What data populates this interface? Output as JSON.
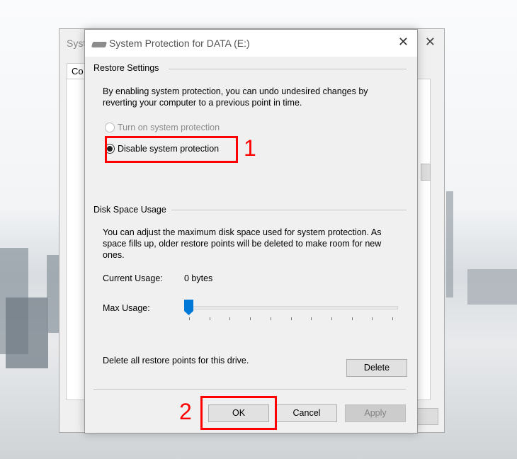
{
  "background_window": {
    "title_fragment": "Syst",
    "tab_fragment": "Co"
  },
  "dialog": {
    "title": "System Protection for DATA (E:)",
    "restore_settings": {
      "heading": "Restore Settings",
      "description": "By enabling system protection, you can undo undesired changes by reverting your computer to a previous point in time.",
      "options": [
        {
          "label": "Turn on system protection",
          "selected": false,
          "enabled": false
        },
        {
          "label": "Disable system protection",
          "selected": true,
          "enabled": true
        }
      ]
    },
    "disk_space": {
      "heading": "Disk Space Usage",
      "description": "You can adjust the maximum disk space used for system protection. As space fills up, older restore points will be deleted to make room for new ones.",
      "current_usage_label": "Current Usage:",
      "current_usage_value": "0 bytes",
      "max_usage_label": "Max Usage:",
      "max_usage_percent": 0,
      "delete_text": "Delete all restore points for this drive.",
      "delete_label": "Delete"
    },
    "buttons": {
      "ok": "OK",
      "cancel": "Cancel",
      "apply": "Apply"
    }
  },
  "annotations": {
    "step1": "1",
    "step2": "2",
    "color": "#ff0000"
  },
  "accent_color": "#0078d7"
}
